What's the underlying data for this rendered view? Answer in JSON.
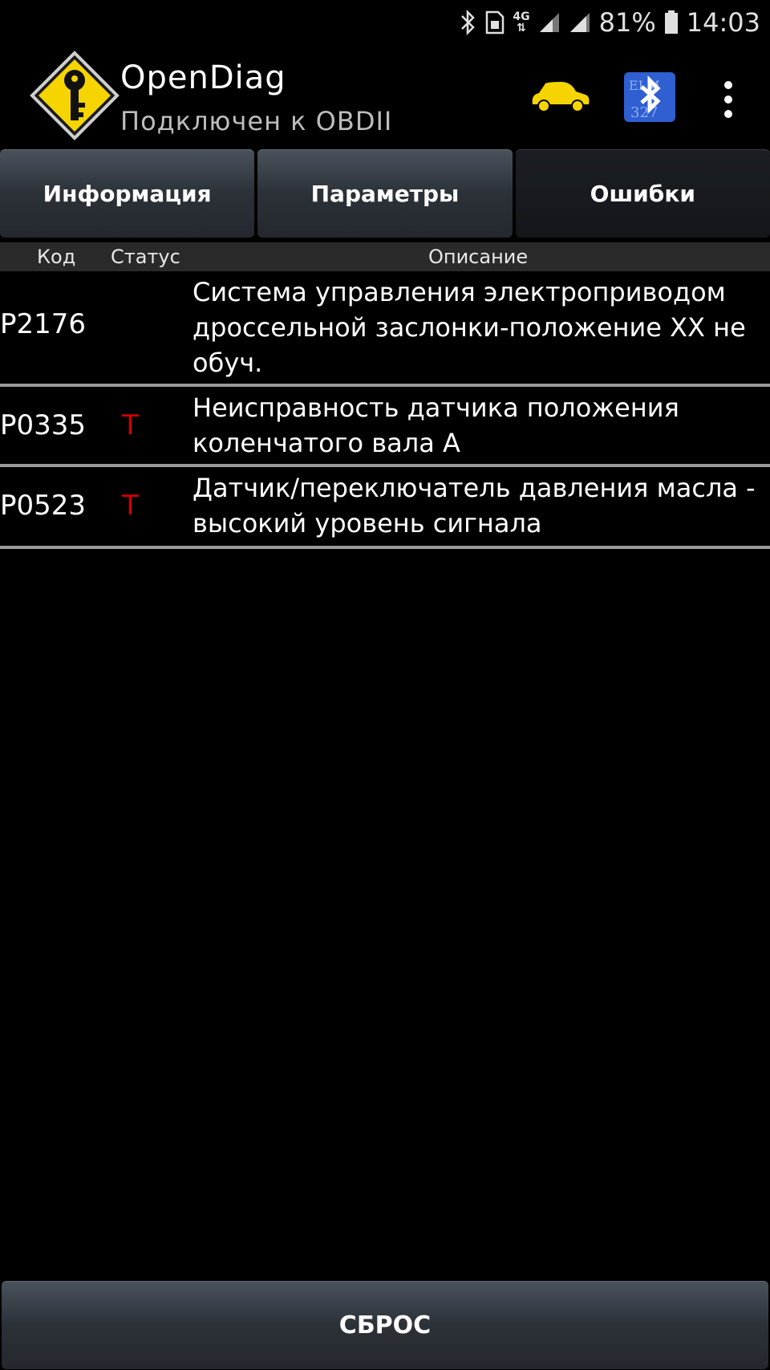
{
  "status_bar": {
    "battery": "81%",
    "time": "14:03",
    "network": "4G"
  },
  "app": {
    "title": "OpenDiag",
    "subtitle": "Подключен к OBDII"
  },
  "icons": {
    "logo": "app-logo-key-icon",
    "car": "car-icon",
    "bluetooth": "bluetooth-elm327-icon",
    "menu": "overflow-menu-icon"
  },
  "tabs": [
    {
      "label": "Информация",
      "active": false
    },
    {
      "label": "Параметры",
      "active": false
    },
    {
      "label": "Ошибки",
      "active": true
    }
  ],
  "table": {
    "headers": {
      "code": "Код",
      "status": "Статус",
      "description": "Описание"
    },
    "rows": [
      {
        "code": "P2176",
        "status": "",
        "description": "Система управления электроприводом дроссельной заслонки-положение XX не обуч."
      },
      {
        "code": "P0335",
        "status": "T",
        "description": "Неисправность датчика положения коленчатого вала А"
      },
      {
        "code": "P0523",
        "status": "T",
        "description": "Датчик/переключатель давления масла - высокий уровень сигнала"
      }
    ]
  },
  "buttons": {
    "reset": "СБРОС"
  },
  "colors": {
    "status_red": "#d00000",
    "car_yellow": "#f5d400",
    "logo_yellow": "#f5d400",
    "bt_blue": "#2f5fd0"
  }
}
